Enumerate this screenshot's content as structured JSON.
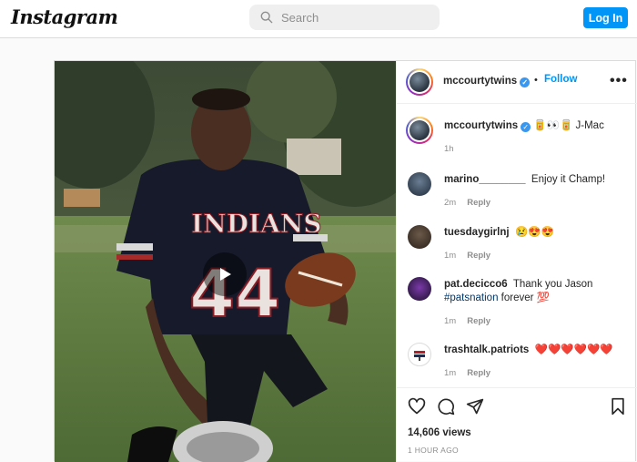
{
  "topbar": {
    "logo_text": "Instagram",
    "search_placeholder": "Search",
    "login_label": "Log In"
  },
  "post": {
    "author": "mccourtytwins",
    "follow_label": "Follow",
    "dot": "•",
    "more": "•••",
    "caption": {
      "user": "mccourtytwins",
      "text": "🥫👀🥫 J-Mac",
      "time": "1h"
    },
    "comments": [
      {
        "user": "marino________",
        "text": "Enjoy it Champ!",
        "time": "2m",
        "reply": "Reply"
      },
      {
        "user": "tuesdaygirlnj",
        "text": "😢😍😍",
        "time": "1m",
        "reply": "Reply"
      },
      {
        "user": "pat.decicco6",
        "text": "Thank you Jason",
        "hashtag": "#patsnation",
        "text_after": " forever 💯",
        "time": "1m",
        "reply": "Reply"
      },
      {
        "user": "trashtalk.patriots",
        "text": "❤️❤️❤️❤️❤️❤️",
        "time": "1m",
        "reply": "Reply"
      }
    ],
    "views": "14,606 views",
    "time_ago": "1 HOUR AGO",
    "jersey_text": "INDIANS",
    "jersey_number": "44"
  },
  "colors": {
    "accent": "#0095f6",
    "verified": "#3897f0",
    "hashtag": "#00376b",
    "muted": "#8e8e8e"
  }
}
